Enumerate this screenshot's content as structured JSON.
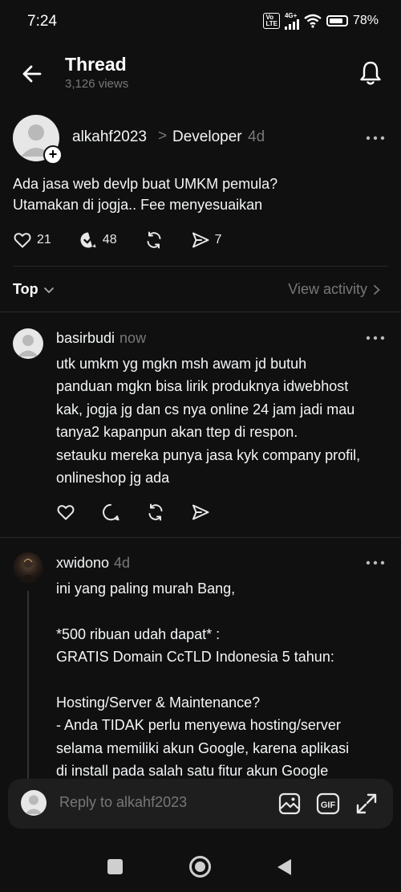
{
  "status_bar": {
    "time": "7:24",
    "volte": "Vo LTE",
    "network": "4G+",
    "battery": "78%",
    "battery_level": 0.78
  },
  "header": {
    "title": "Thread",
    "views": "3,126 views"
  },
  "post": {
    "author": "alkahf2023",
    "separator": ">",
    "topic": "Developer",
    "time": "4d",
    "text_line1": "Ada jasa web devlp buat UMKM pemula?",
    "text_line2": "Utamakan di jogja.. Fee menyesuaikan",
    "likes": "21",
    "replies": "48",
    "shares": "7"
  },
  "sort": {
    "label": "Top",
    "view_activity": "View activity"
  },
  "replies": [
    {
      "author": "basirbudi",
      "time": "now",
      "text": "utk umkm yg mgkn msh awam jd butuh\npanduan mgkn bisa lirik produknya idwebhost\nkak, jogja jg dan cs nya online 24 jam jadi mau\ntanya2 kapanpun akan ttep di respon.\nsetauku mereka punya jasa kyk company profil,\nonlineshop jg ada"
    },
    {
      "author": "xwidono",
      "time": "4d",
      "text": "ini yang paling murah Bang,\n\n *500 ribuan udah dapat* :\nGRATIS Domain CcTLD Indonesia 5 tahun:\n\nHosting/Server & Maintenance?\n- Anda TIDAK perlu menyewa hosting/server\nselama memiliki akun Google, karena aplikasi\ndi install pada salah satu fitur akun Google\nyang Anda miliki"
    }
  ],
  "reply_bar": {
    "placeholder": "Reply to alkahf2023"
  },
  "icons": {
    "back": "arrow-left-icon",
    "bell": "bell-icon",
    "more": "more-horizontal-icon",
    "like": "heart-icon",
    "reply": "comment-icon",
    "repost": "repost-icon",
    "share": "send-icon",
    "image": "image-icon",
    "gif": "gif-icon",
    "expand": "expand-icon"
  },
  "colors": {
    "background": "#101010",
    "text": "#f3f5f7",
    "muted": "#777777",
    "divider": "#2a2a2a"
  }
}
